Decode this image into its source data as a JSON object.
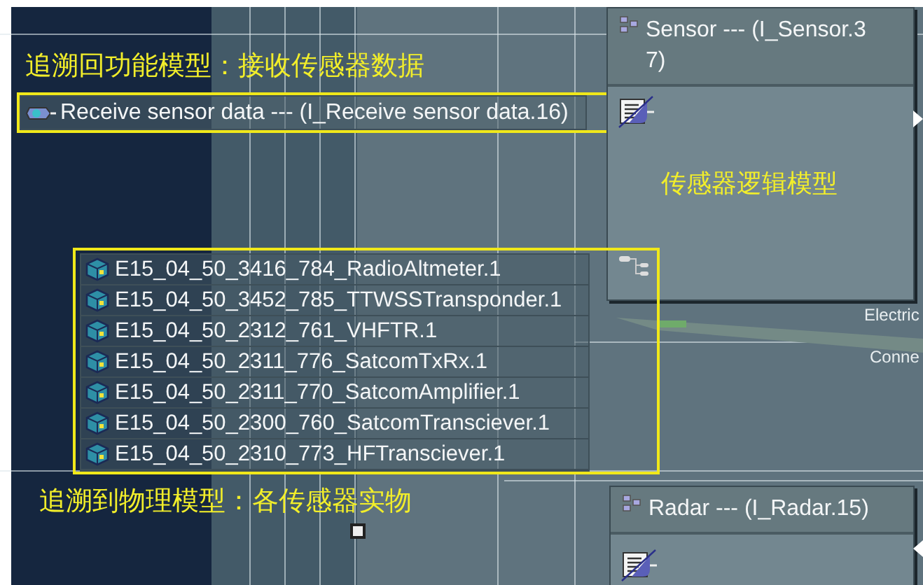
{
  "annotations": [
    {
      "text": "追溯回功能模型：接收传感器数据"
    },
    {
      "text": "传感器逻辑模型"
    },
    {
      "text": "追溯到物理模型：各传感器实物"
    }
  ],
  "function_node": {
    "label": "Receive sensor data --- (I_Receive sensor data.16)"
  },
  "sensor_block": {
    "title_lines": [
      "Sensor --- (I_Sensor.3",
      "7)"
    ]
  },
  "physical_parts": [
    {
      "label": "E15_04_50_3416_784_RadioAltmeter.1"
    },
    {
      "label": "E15_04_50_3452_785_TTWSSTransponder.1"
    },
    {
      "label": "E15_04_50_2312_761_VHFTR.1"
    },
    {
      "label": "E15_04_50_2311_776_SatcomTxRx.1"
    },
    {
      "label": "E15_04_50_2311_770_SatcomAmplifier.1"
    },
    {
      "label": "E15_04_50_2300_760_SatcomTransciever.1"
    },
    {
      "label": "E15_04_50_2310_773_HFTransciever.1"
    }
  ],
  "connector_labels": [
    "Electric",
    "Conne"
  ],
  "radar_block": {
    "title": "Radar --- (I_Radar.15)"
  }
}
